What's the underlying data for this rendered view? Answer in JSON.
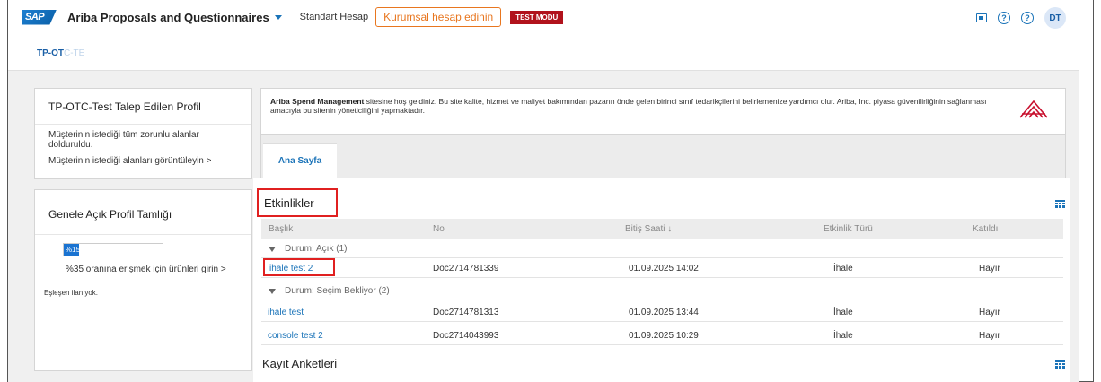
{
  "header": {
    "logo": "SAP",
    "app_title": "Ariba Proposals and Questionnaires",
    "account_type": "Standart Hesap",
    "upgrade_button": "Kurumsal hesap edinin",
    "test_badge": "TEST MODU",
    "icons": [
      "chat-icon",
      "help-icon",
      "help-icon"
    ],
    "avatar_initials": "DT"
  },
  "breadcrumb": {
    "main": "TP-OT",
    "faded": "C-TE"
  },
  "profile_card": {
    "title": "TP-OTC-Test Talep Edilen Profil",
    "status": "Müşterinin istediği tüm zorunlu alanlar dolduruldu.",
    "link": "Müşterinin istediği alanları görüntüleyin >"
  },
  "public_profile_card": {
    "title": "Genele Açık Profil Tamlığı",
    "progress_label": "%15",
    "progress_value": 0.15,
    "tip": "%35 oranına erişmek için ürünleri girin >",
    "no_match": "Eşleşen ilan yok."
  },
  "welcome": {
    "brand": "Ariba Spend Management",
    "text": " sitesine hoş geldiniz. Bu site kalite, hizmet ve maliyet bakımından pazarın önde gelen birinci sınıf tedarikçilerini belirlemenize yardımcı olur. Ariba, Inc. piyasa güvenilirliğinin sağlanması amacıyla bu sitenin yöneticiliğini yapmaktadır."
  },
  "tabs": [
    {
      "label": "Ana Sayfa"
    }
  ],
  "events": {
    "title": "Etkinlikler",
    "columns": [
      "Başlık",
      "No",
      "Bitiş Saati ↓",
      "Etkinlik Türü",
      "Katıldı"
    ],
    "groups": [
      {
        "label": "Durum: Açık  (1)",
        "rows": [
          {
            "title": "ihale test 2",
            "no": "Doc2714781339",
            "end": "01.09.2025 14:02",
            "type": "İhale",
            "joined": "Hayır"
          }
        ]
      },
      {
        "label": "Durum: Seçim Bekliyor  (2)",
        "rows": [
          {
            "title": "ihale test",
            "no": "Doc2714781313",
            "end": "01.09.2025 13:44",
            "type": "İhale",
            "joined": "Hayır"
          },
          {
            "title": "console test 2",
            "no": "Doc2714043993",
            "end": "01.09.2025 10:29",
            "type": "İhale",
            "joined": "Hayır"
          }
        ]
      }
    ]
  },
  "surveys": {
    "title": "Kayıt Anketleri"
  },
  "colors": {
    "accent": "#1a73b8",
    "highlight": "#e02020",
    "upgrade": "#e8761f",
    "test_badge": "#b1121c"
  }
}
